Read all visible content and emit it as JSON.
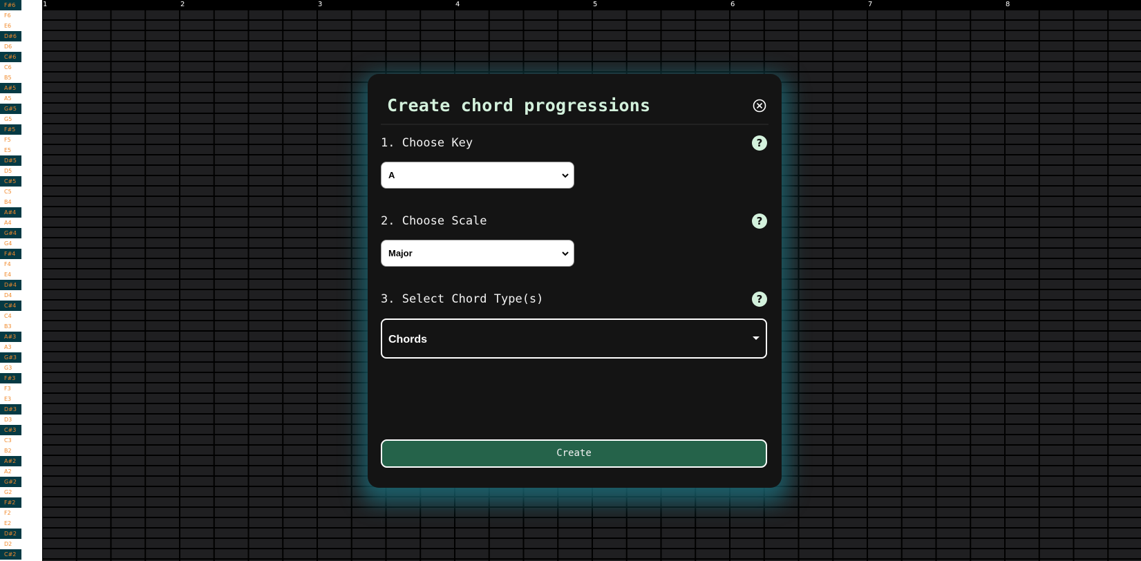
{
  "piano_roll": {
    "keys": [
      "F#6",
      "F6",
      "E6",
      "D#6",
      "D6",
      "C#6",
      "C6",
      "B5",
      "A#5",
      "A5",
      "G#5",
      "G5",
      "F#5",
      "F5",
      "E5",
      "D#5",
      "D5",
      "C#5",
      "C5",
      "B4",
      "A#4",
      "A4",
      "G#4",
      "G4",
      "F#4",
      "F4",
      "E4",
      "D#4",
      "D4",
      "C#4",
      "C4",
      "B3",
      "A#3",
      "A3",
      "G#3",
      "G3",
      "F#3",
      "F3",
      "E3",
      "D#3",
      "D3",
      "C#3",
      "C3",
      "B2",
      "A#2",
      "A2",
      "G#2",
      "G2",
      "F#2",
      "F2",
      "E2",
      "D#2",
      "D2",
      "C#2"
    ],
    "bar_numbers": [
      "1",
      "2",
      "3",
      "4",
      "5",
      "6",
      "7",
      "8"
    ],
    "colors": {
      "sharp_key_bg": "#053a44",
      "key_label": "#f08a2c",
      "natural_key_bg": "#ffffff",
      "grid_cell": "#1f1f21"
    }
  },
  "modal": {
    "title": "Create chord progressions",
    "close_icon": "circle-x-icon",
    "steps": [
      {
        "label": "1. Choose Key",
        "help_icon": "?",
        "selected": "A"
      },
      {
        "label": "2. Choose Scale",
        "help_icon": "?",
        "selected": "Major"
      },
      {
        "label": "3. Select Chord Type(s)",
        "help_icon": "?",
        "placeholder": "Chords"
      }
    ],
    "create_label": "Create",
    "colors": {
      "title": "#d3f1dc",
      "background": "#141414",
      "glow": "#1b6876",
      "create_button": "#25634a"
    }
  }
}
